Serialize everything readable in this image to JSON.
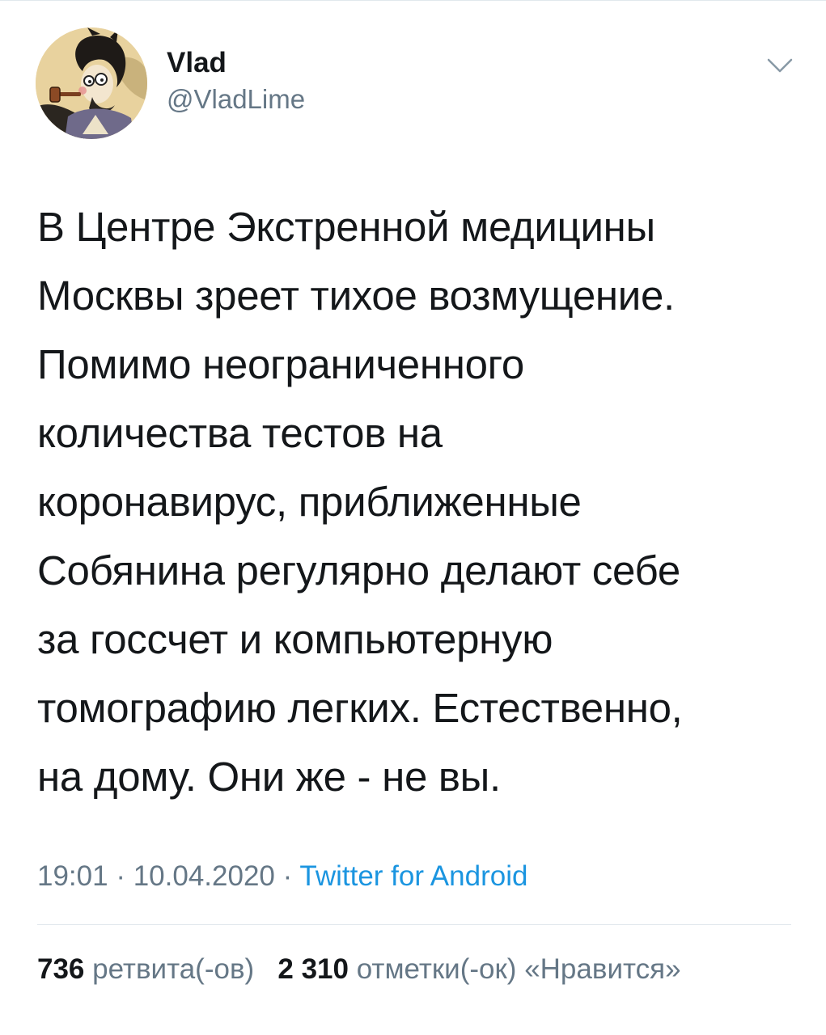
{
  "tweet": {
    "author": {
      "display_name": "Vlad",
      "handle": "@VladLime",
      "avatar_icon": "cartoon-character-with-pipe-avatar"
    },
    "menu_icon": "chevron-down-icon",
    "text": "В Центре Экстренной медицины\nМосквы зреет тихое возмущение.\nПомимо неограниченного\nколичества тестов на\nкоронавирус, приближенные\nСобянина регулярно делают себе\nза госсчет и компьютерную\nтомографию легких. Естественно,\nна дому. Они же - не вы.",
    "time": "19:01",
    "date": "10.04.2020",
    "separator": "·",
    "source": "Twitter for Android",
    "stats": {
      "retweets_count": "736",
      "retweets_label": "ретвита(-ов)",
      "likes_count": "2 310",
      "likes_label": "отметки(-ок) «Нравится»"
    }
  },
  "colors": {
    "text_primary": "#14171a",
    "text_secondary": "#657786",
    "link": "#1b95e0",
    "divider": "#e1e8ed"
  }
}
